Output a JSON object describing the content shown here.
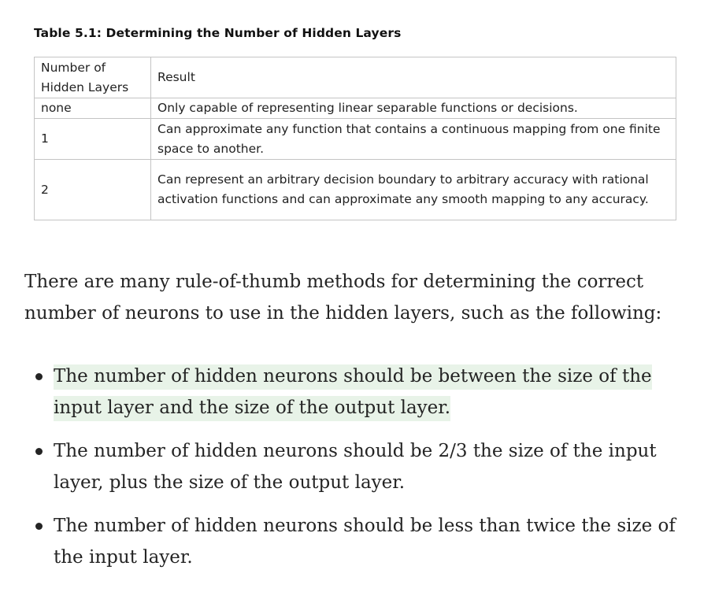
{
  "table": {
    "title": "Table 5.1: Determining the Number of Hidden Layers",
    "headers": [
      "Number of Hidden Layers",
      "Result"
    ],
    "rows": [
      [
        "none",
        "Only capable of representing linear separable functions or decisions."
      ],
      [
        "1",
        "Can approximate any function that contains a continuous mapping from one finite space to another."
      ],
      [
        "2",
        "Can represent an arbitrary decision boundary to arbitrary accuracy with rational activation functions and can approximate any smooth mapping to any accuracy."
      ]
    ]
  },
  "intro": "There are many rule-of-thumb methods for determining the correct number of neurons to use in the hidden layers, such as the following:",
  "rules": [
    "The number of hidden neurons should be between the size of the input layer and the size of the output layer.",
    "The number of hidden neurons should be 2/3 the size of the input layer, plus the size of the output layer.",
    "The number of hidden neurons should be less than twice the size of the input layer."
  ],
  "colors": {
    "highlight": "#e8f3e8",
    "table_border": "#c4c4c4",
    "text": "#242424"
  }
}
